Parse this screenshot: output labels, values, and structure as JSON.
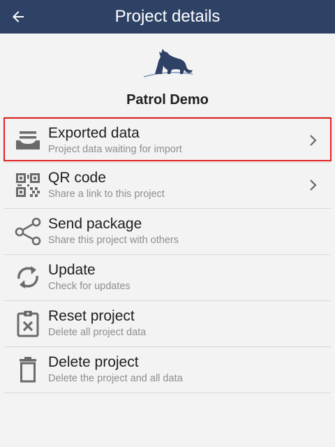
{
  "header": {
    "title": "Project details",
    "back_icon": "arrow-left-icon",
    "background": "#2e4266"
  },
  "project": {
    "name": "Patrol Demo",
    "logo": "jaguar-logo-icon"
  },
  "menu": {
    "items": [
      {
        "title": "Exported data",
        "subtitle": "Project data waiting for import",
        "icon": "tray-icon",
        "chevron": true,
        "highlighted": true
      },
      {
        "title": "QR code",
        "subtitle": "Share a link to this project",
        "icon": "qr-code-icon",
        "chevron": true
      },
      {
        "title": "Send package",
        "subtitle": "Share this project with others",
        "icon": "share-icon",
        "chevron": false
      },
      {
        "title": "Update",
        "subtitle": "Check for updates",
        "icon": "sync-icon",
        "chevron": false
      },
      {
        "title": "Reset project",
        "subtitle": "Delete all project data",
        "icon": "clipboard-x-icon",
        "chevron": false
      },
      {
        "title": "Delete project",
        "subtitle": "Delete the project and all data",
        "icon": "trash-icon",
        "chevron": false
      }
    ]
  },
  "colors": {
    "highlight_border": "#e02020",
    "icon": "#6a6a6a"
  }
}
